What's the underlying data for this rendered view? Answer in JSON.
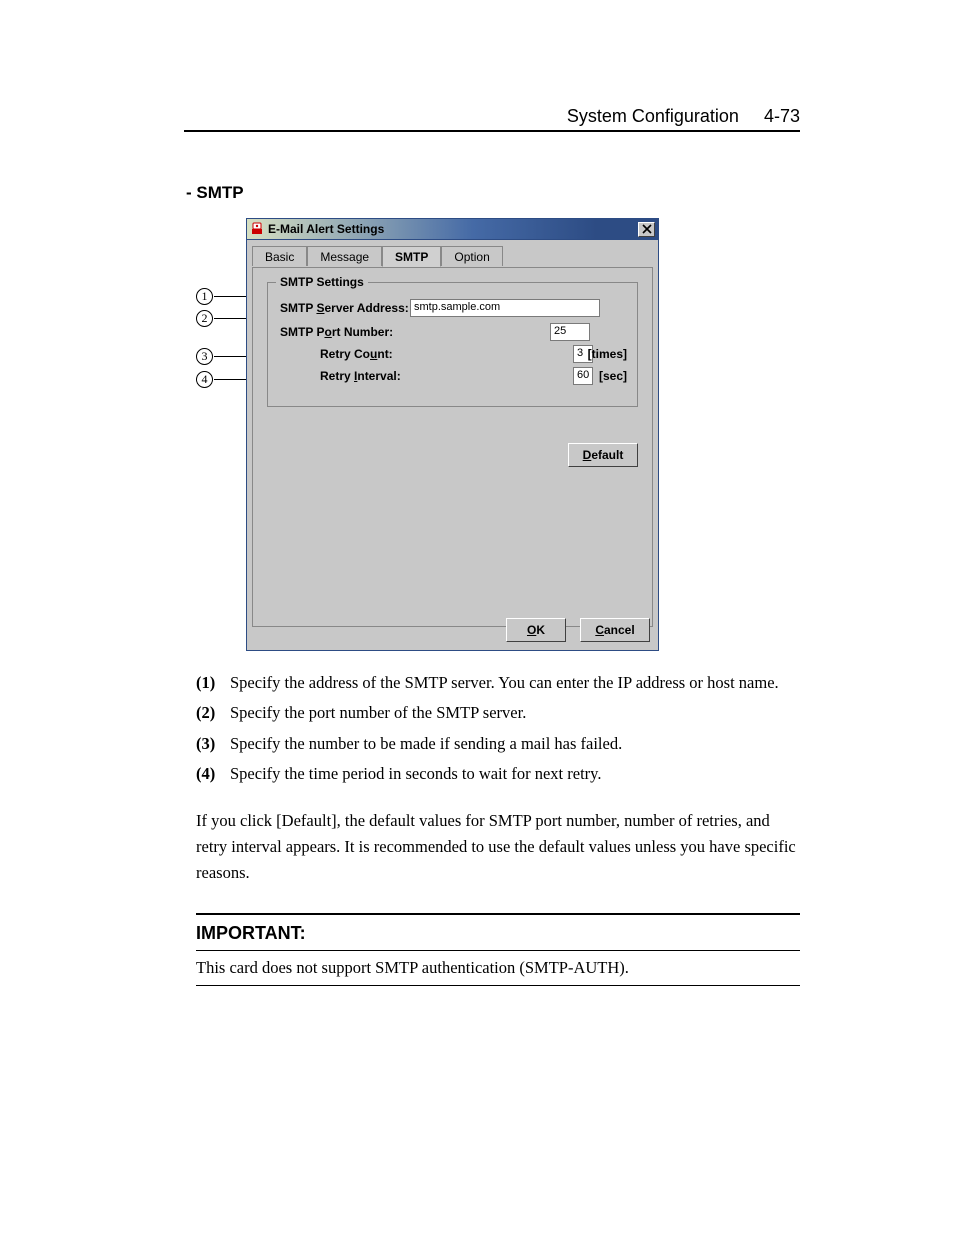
{
  "header": {
    "chapter": "System Configuration",
    "pagenum": "4-73"
  },
  "section": {
    "heading": "- SMTP"
  },
  "dialog": {
    "title": "E-Mail Alert Settings",
    "tabs": [
      "Basic",
      "Message",
      "SMTP",
      "Option"
    ],
    "active_tab": "SMTP",
    "group_legend": "SMTP Settings",
    "fields": {
      "server_label_pre": "SMTP ",
      "server_label_mn": "S",
      "server_label_post": "erver Address:",
      "server_value": "smtp.sample.com",
      "port_label_pre": "SMTP P",
      "port_label_mn": "o",
      "port_label_post": "rt Number:",
      "port_value": "25",
      "retry_count_label_pre": "Retry Co",
      "retry_count_label_mn": "u",
      "retry_count_label_post": "nt:",
      "retry_count_value": "3",
      "retry_count_unit": "[times]",
      "retry_interval_label_pre": "Retry ",
      "retry_interval_label_mn": "I",
      "retry_interval_label_post": "nterval:",
      "retry_interval_value": "60",
      "retry_interval_unit": "[sec]"
    },
    "buttons": {
      "default_mn": "D",
      "default_post": "efault",
      "ok_mn": "O",
      "ok_post": "K",
      "cancel_mn": "C",
      "cancel_post": "ancel"
    }
  },
  "callouts": [
    "1",
    "2",
    "3",
    "4"
  ],
  "descriptions": [
    {
      "num": "(1)",
      "text": "Specify the address of the SMTP server. You can enter the IP address or host name."
    },
    {
      "num": "(2)",
      "text": "Specify the port number of the SMTP server."
    },
    {
      "num": "(3)",
      "text": "Specify the number to be made if sending a mail has failed."
    },
    {
      "num": "(4)",
      "text": "Specify the time period in seconds to wait for next retry."
    }
  ],
  "note_paragraph": "If you click [Default], the default values for SMTP port number, number of retries, and retry interval appears. It is recommended to use the default values unless you have specific reasons.",
  "important": {
    "label": "IMPORTANT:",
    "text": "This card does not support SMTP authentication (SMTP-AUTH)."
  }
}
